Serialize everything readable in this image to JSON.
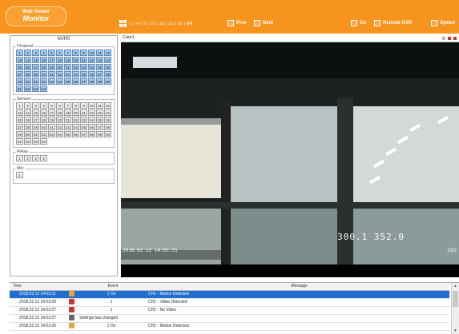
{
  "header": {
    "logo_line1": "Web Viewer",
    "logo_line2": "Monitor",
    "split_modes": [
      "1",
      "4",
      "9",
      "13",
      "16",
      "25",
      "36",
      "64"
    ],
    "prev_label": "Prev",
    "next_label": "Next",
    "go_label": "Go",
    "remote_dvr_label": "Remote DVR",
    "option_label": "Option"
  },
  "left_panel": {
    "title": "NVR0",
    "channel_label": "Channel",
    "channels": [
      "1",
      "2",
      "3",
      "4",
      "5",
      "6",
      "7",
      "8",
      "9",
      "10",
      "11",
      "12",
      "13",
      "14",
      "15",
      "16",
      "17",
      "18",
      "19",
      "20",
      "21",
      "22",
      "23",
      "24",
      "25",
      "26",
      "27",
      "28",
      "29",
      "30",
      "31",
      "32",
      "33",
      "34",
      "35",
      "36",
      "37",
      "38",
      "39",
      "40",
      "41",
      "42",
      "43",
      "44",
      "45",
      "46",
      "47",
      "48",
      "49",
      "50",
      "51",
      "52",
      "53",
      "54",
      "55",
      "56",
      "57",
      "58",
      "59",
      "60",
      "61",
      "62",
      "63",
      "64"
    ],
    "sensor_label": "Sensor",
    "sensors": [
      "1",
      "2",
      "3",
      "4",
      "5",
      "6",
      "7",
      "8",
      "9",
      "10",
      "11",
      "12",
      "13",
      "14",
      "15",
      "16",
      "17",
      "18",
      "19",
      "20",
      "21",
      "22",
      "23",
      "24",
      "25",
      "26",
      "27",
      "28",
      "29",
      "30",
      "31",
      "32",
      "33",
      "34",
      "35",
      "36",
      "37",
      "38",
      "39",
      "40",
      "41",
      "42",
      "43",
      "44",
      "45",
      "46",
      "47",
      "48",
      "49",
      "50",
      "51",
      "52",
      "53",
      "54",
      "55",
      "56",
      "57",
      "58",
      "59",
      "60",
      "61",
      "62",
      "63",
      "64"
    ],
    "relay_label": "Relay",
    "relays": [
      "1",
      "2",
      "3",
      "4"
    ],
    "mic_label": "Mic",
    "mics": [
      "1"
    ]
  },
  "camera": {
    "title": "Cam1",
    "reading": "300.1 352.0",
    "timestamp": "2018.02.12 14:03:31",
    "label": "31/2"
  },
  "log": {
    "col_time": "Time",
    "col_event": "Event",
    "col_message": "Message",
    "rows": [
      {
        "time": "2018.02.12 14:03:31",
        "icon": "motion-icon",
        "event": "1 On",
        "message": "CH1 - Motion Detected",
        "selected": true
      },
      {
        "time": "2018.02.12 14:03:29",
        "icon": "video-icon",
        "event": "1",
        "message": "CH1 - Video Detected",
        "selected": false
      },
      {
        "time": "2018.02.12 14:03:27",
        "icon": "video-icon",
        "event": "1",
        "message": "CH1 - No Video",
        "selected": false
      },
      {
        "time": "2018.02.12 14:03:27",
        "icon": "settings-icon",
        "event": "Settings has changed",
        "message": "",
        "selected": false
      },
      {
        "time": "2018.02.12 14:03:26",
        "icon": "motion-icon",
        "event": "1 On",
        "message": "CH1 - Motion Detected",
        "selected": false
      }
    ]
  },
  "colors": {
    "accent": "#f7941d",
    "selection": "#1e6fcf"
  }
}
